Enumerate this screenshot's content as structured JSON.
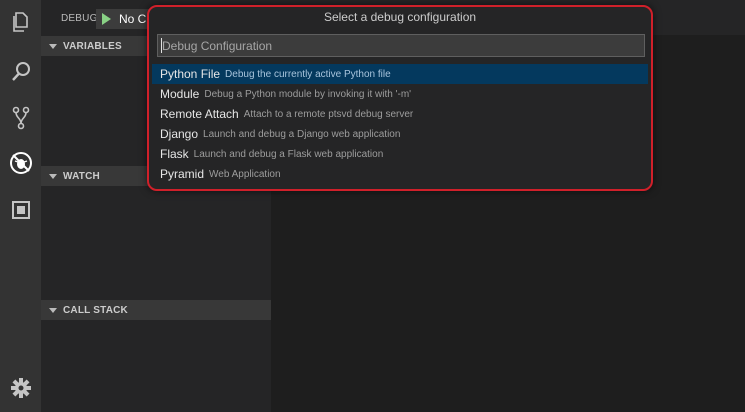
{
  "activity_bar": {
    "icons": [
      "files-icon",
      "search-icon",
      "source-control-icon",
      "debug-icon",
      "extensions-icon"
    ],
    "bottom_icon": "gear-icon"
  },
  "debug": {
    "title": "DEBUG",
    "config_name": "No C"
  },
  "sections": {
    "variables": "VARIABLES",
    "watch": "WATCH",
    "call_stack": "CALL STACK"
  },
  "quick_pick": {
    "title": "Select a debug configuration",
    "placeholder": "Debug Configuration",
    "items": [
      {
        "label": "Python File",
        "description": "Debug the currently active Python file",
        "selected": true
      },
      {
        "label": "Module",
        "description": "Debug a Python module by invoking it with '-m'",
        "selected": false
      },
      {
        "label": "Remote Attach",
        "description": "Attach to a remote ptsvd debug server",
        "selected": false
      },
      {
        "label": "Django",
        "description": "Launch and debug a Django web application",
        "selected": false
      },
      {
        "label": "Flask",
        "description": "Launch and debug a Flask web application",
        "selected": false
      },
      {
        "label": "Pyramid",
        "description": "Web Application",
        "selected": false
      }
    ]
  },
  "colors": {
    "highlight_border": "#d0202a",
    "selection": "#04395e",
    "play": "#89d185"
  }
}
